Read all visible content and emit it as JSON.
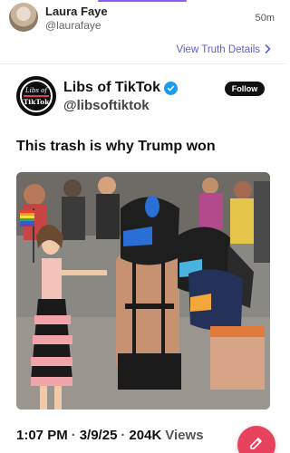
{
  "header": {
    "author_name": "Laura Faye",
    "author_handle": "@laurafaye",
    "time_ago": "50m"
  },
  "truth_link": {
    "label": "View Truth Details",
    "icon": "chevron-right-icon"
  },
  "embed": {
    "name": "Libs of TikTok",
    "handle": "@libsoftiktok",
    "follow_label": "Follow",
    "avatar_logo_top": "Libs of",
    "avatar_logo_bottom": "TikTok",
    "text": "This trash is why Trump won",
    "time": "1:07 PM",
    "date": "3/9/25",
    "views_count": "204K",
    "views_label": "Views"
  },
  "fab": {
    "icon": "compose-icon"
  },
  "colors": {
    "accent": "#8b5cf6",
    "link": "#5a5fd6",
    "verified": "#1d9bf0",
    "fab": "#e8425e"
  }
}
